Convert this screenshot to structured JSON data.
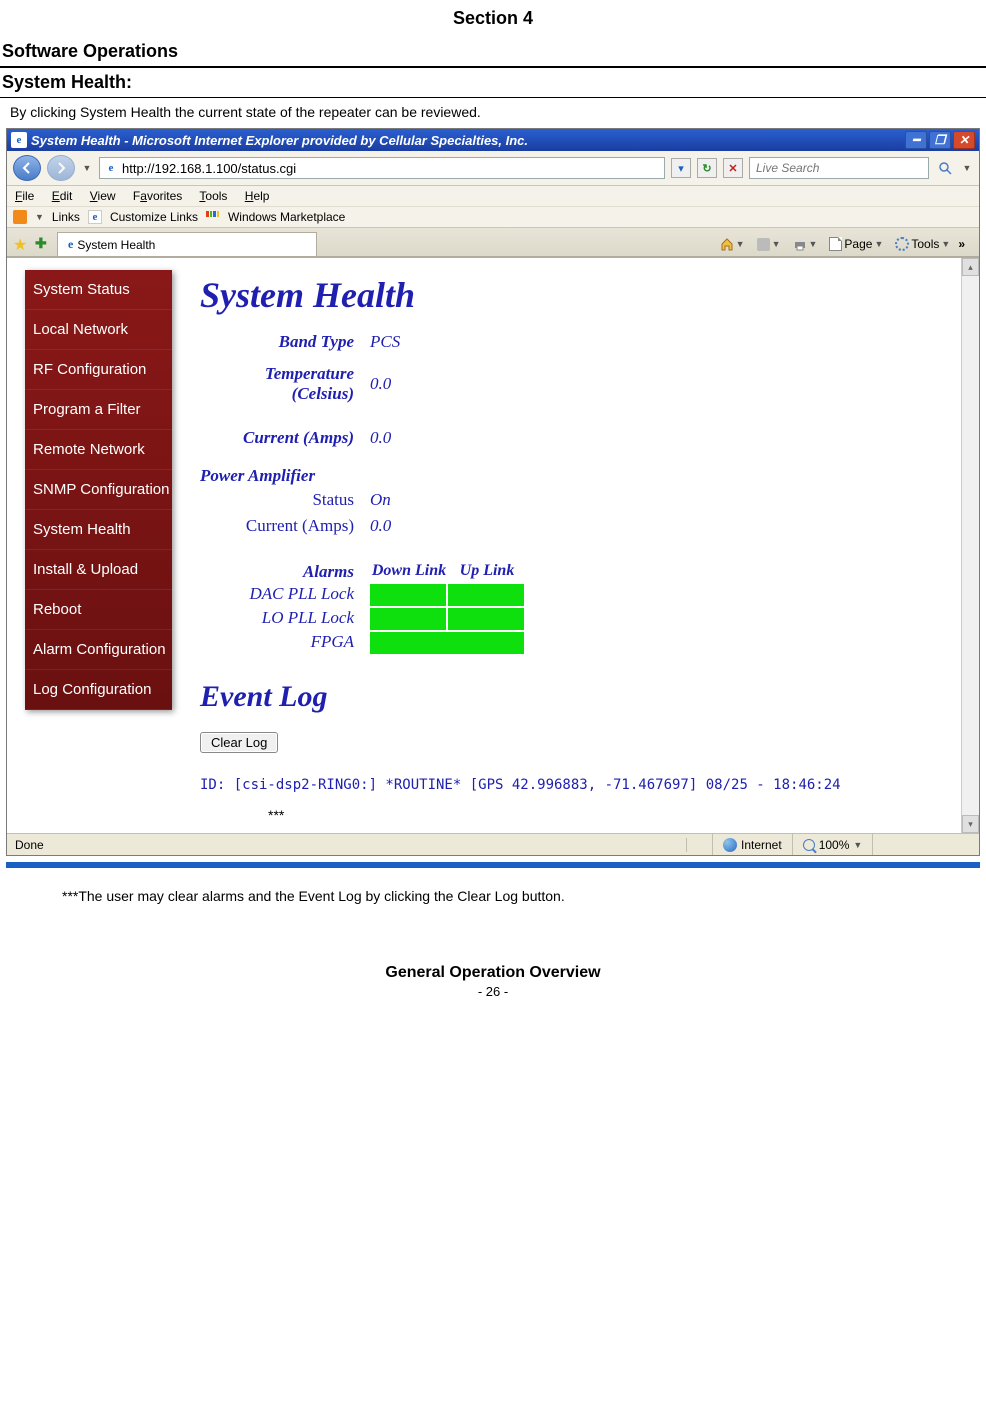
{
  "doc": {
    "section": "Section 4",
    "sw_ops": "Software Operations",
    "sys_health": "System Health:",
    "intro": "By clicking System Health the current state of the repeater can be reviewed.",
    "stars": "***",
    "note": "***The user may clear alarms and the Event Log by clicking the Clear Log button.",
    "footer1": "General Operation Overview",
    "footer2": "- 26 -"
  },
  "browser": {
    "title": "System Health - Microsoft Internet Explorer provided by Cellular Specialties, Inc.",
    "url": "http://192.168.1.100/status.cgi",
    "search_placeholder": "Live Search",
    "menu": {
      "file": "File",
      "edit": "Edit",
      "view": "View",
      "favorites": "Favorites",
      "tools": "Tools",
      "help": "Help"
    },
    "links": {
      "links_label": "Links",
      "customize": "Customize Links",
      "marketplace": "Windows Marketplace"
    },
    "tab_label": "System Health",
    "tools_bar": {
      "page": "Page",
      "tools": "Tools"
    },
    "status": {
      "done": "Done",
      "zone": "Internet",
      "zoom": "100%"
    }
  },
  "sidemenu": {
    "items": [
      "System Status",
      "Local Network",
      "RF Configuration",
      "Program a Filter",
      "Remote Network",
      "SNMP Configuration",
      "System Health",
      "Install & Upload",
      "Reboot",
      "Alarm Configuration",
      "Log Configuration"
    ]
  },
  "page": {
    "title": "System Health",
    "band_label": "Band Type",
    "band_value": "PCS",
    "temp_label1": "Temperature",
    "temp_label2": "(Celsius)",
    "temp_value": "0.0",
    "current_label": "Current (Amps)",
    "current_value": "0.0",
    "pa_header": "Power Amplifier",
    "pa_status_label": "Status",
    "pa_status_value": "On",
    "pa_current_label": "Current (Amps)",
    "pa_current_value": "0.0",
    "alarms_label": "Alarms",
    "downlink": "Down Link",
    "uplink": "Up Link",
    "alarm_rows": [
      "DAC PLL Lock",
      "LO PLL Lock",
      "FPGA"
    ],
    "event_log": "Event Log",
    "clear_btn": "Clear Log",
    "logline": "ID: [csi-dsp2-RING0:] *ROUTINE* [GPS 42.996883, -71.467697] 08/25 - 18:46:24"
  }
}
